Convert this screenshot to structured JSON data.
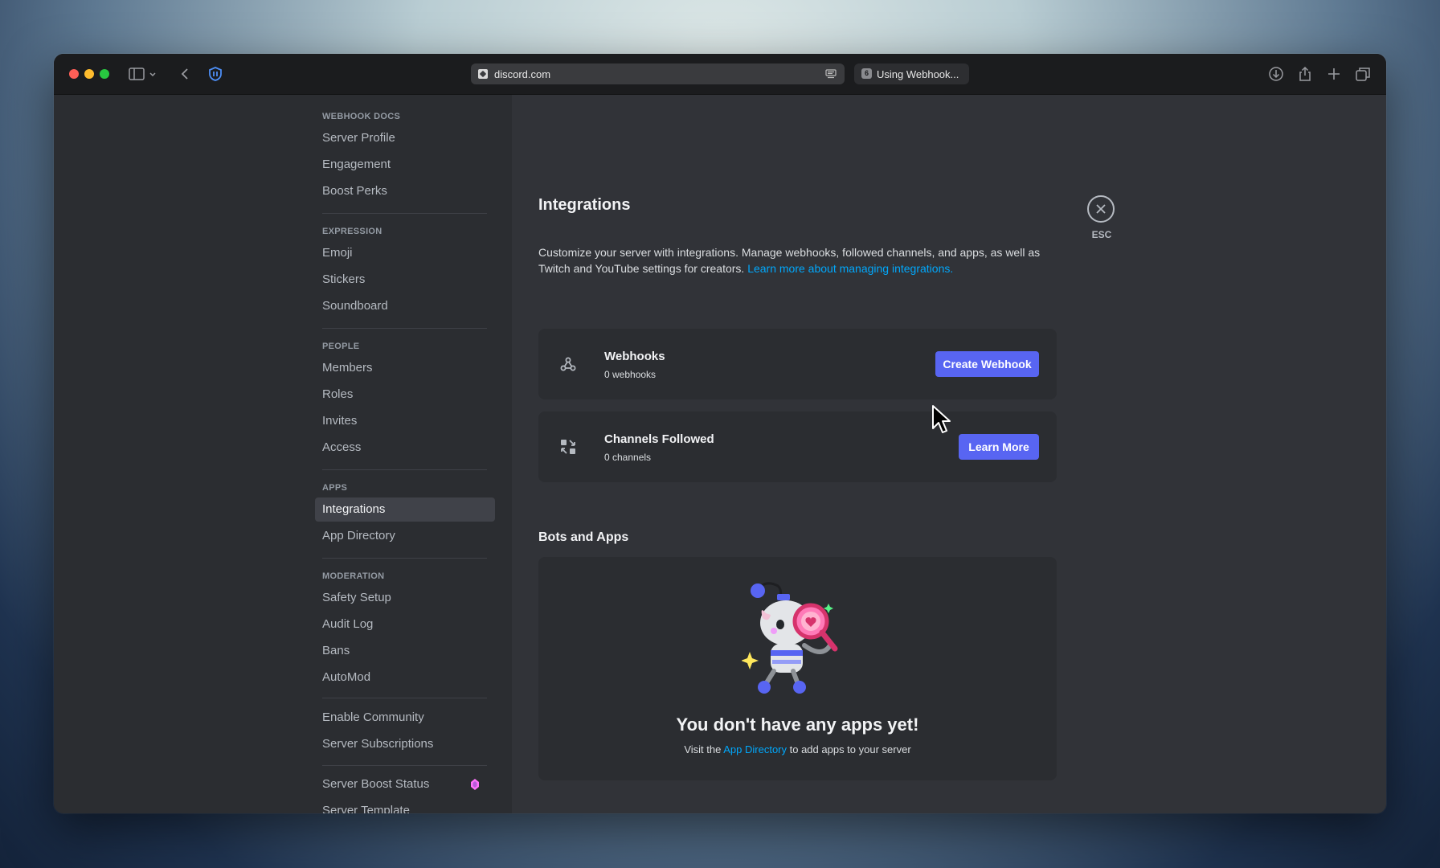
{
  "browser": {
    "url": "discord.com",
    "tab_title": "Using Webhook...",
    "tab_favicon": "6"
  },
  "sidebar": {
    "sections": [
      {
        "header": "WEBHOOK DOCS",
        "items": [
          "Server Profile",
          "Engagement",
          "Boost Perks"
        ]
      },
      {
        "header": "EXPRESSION",
        "items": [
          "Emoji",
          "Stickers",
          "Soundboard"
        ]
      },
      {
        "header": "PEOPLE",
        "items": [
          "Members",
          "Roles",
          "Invites",
          "Access"
        ]
      },
      {
        "header": "APPS",
        "items": [
          "Integrations",
          "App Directory"
        ]
      },
      {
        "header": "MODERATION",
        "items": [
          "Safety Setup",
          "Audit Log",
          "Bans",
          "AutoMod"
        ]
      }
    ],
    "extra": [
      "Enable Community",
      "Server Subscriptions"
    ],
    "boost_status": "Server Boost Status",
    "template": "Server Template",
    "active_item": "Integrations"
  },
  "main": {
    "title": "Integrations",
    "description": "Customize your server with integrations. Manage webhooks, followed channels, and apps, as well as Twitch and YouTube settings for creators.",
    "description_link": "Learn more about managing integrations.",
    "webhooks": {
      "name": "Webhooks",
      "count": "0 webhooks",
      "button": "Create Webhook"
    },
    "channels": {
      "name": "Channels Followed",
      "count": "0 channels",
      "button": "Learn More"
    },
    "bots_header": "Bots and Apps",
    "empty_title": "You don't have any apps yet!",
    "empty_pre": "Visit the",
    "empty_link": "App Directory",
    "empty_post": "to add apps to your server"
  },
  "close": {
    "label": "ESC"
  },
  "colors": {
    "accent": "#5865f2",
    "link": "#00a8fc",
    "boost_pink": "#ff73fa"
  },
  "icons": [
    "sidebar-toggle-icon",
    "back-chevron-icon",
    "shield-extension-icon",
    "reader-icon",
    "download-icon",
    "share-icon",
    "plus-icon",
    "tabs-overview-icon",
    "webhook-icon",
    "channels-followed-icon",
    "close-icon",
    "boost-gem-icon"
  ]
}
